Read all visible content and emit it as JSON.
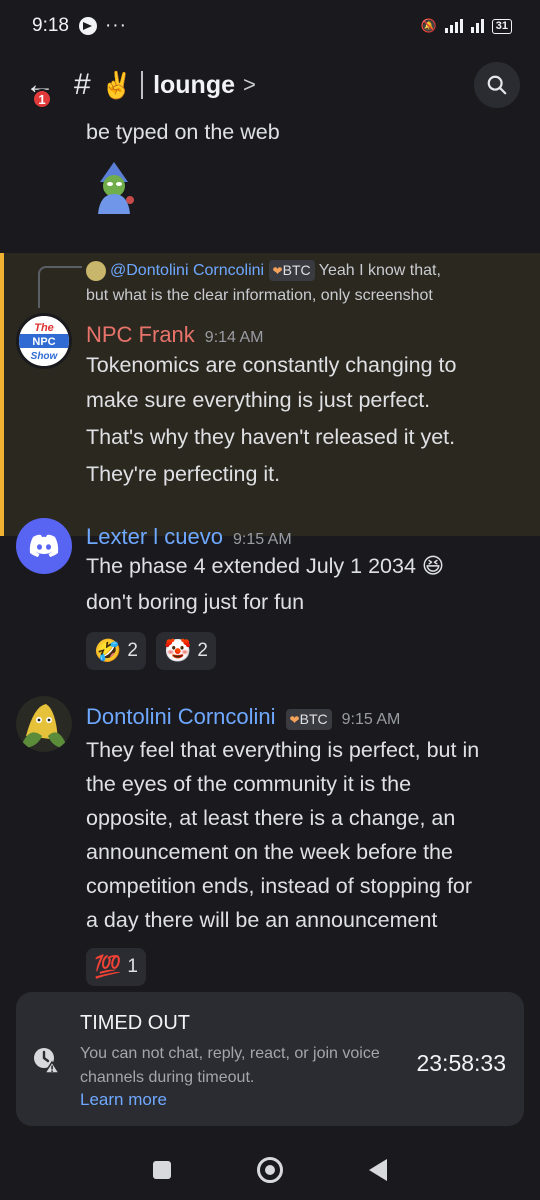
{
  "status_bar": {
    "time": "9:18",
    "more": "···",
    "battery": "31"
  },
  "header": {
    "back_badge": "1",
    "hash": "#",
    "channel_emoji": "✌️",
    "channel_name": "lounge",
    "chevron": ">"
  },
  "messages": {
    "prev_tail": "be typed on the web",
    "reply": {
      "mention": "@Dontolini Corncolini",
      "tag": "BTC",
      "text_line1": "Yeah I know that,",
      "text_line2": "but what is the clear information, only screenshot"
    },
    "npc": {
      "avatar_text": {
        "l1": "The",
        "l2": "NPC",
        "l3": "Show"
      },
      "name": "NPC Frank",
      "time": "9:14 AM",
      "lines": [
        "Tokenomics are constantly changing to",
        "make sure everything is just perfect.",
        "That's why they haven't released it yet.",
        "They're perfecting it."
      ]
    },
    "lexter": {
      "name": "Lexter  l cuevo",
      "time": "9:15 AM",
      "lines": [
        "The phase 4 extended July 1 2034",
        "don't boring just for fun"
      ],
      "line1_emoji": "😆",
      "reactions": [
        {
          "emoji": "🤣",
          "count": "2"
        },
        {
          "emoji": "🤡",
          "count": "2"
        }
      ]
    },
    "dontolini": {
      "name": "Dontolini Corncolini",
      "tag": "BTC",
      "time": "9:15 AM",
      "lines": [
        "They feel that everything is perfect, but in",
        "the eyes of the community it is the",
        "opposite, at least there is a change, an",
        "announcement on the week before the",
        "competition ends, instead of stopping for",
        "a day there will be an announcement"
      ],
      "reactions": [
        {
          "emoji": "💯",
          "count": "1"
        }
      ]
    }
  },
  "timeout": {
    "title": "TIMED OUT",
    "text": "You can not chat, reply, react, or join voice channels during timeout.",
    "link": "Learn more",
    "timer": "23:58:33"
  },
  "colors": {
    "npc_name": "#e8736b",
    "blue_name": "#6ea8ff",
    "highlight_border": "#f0b232"
  }
}
